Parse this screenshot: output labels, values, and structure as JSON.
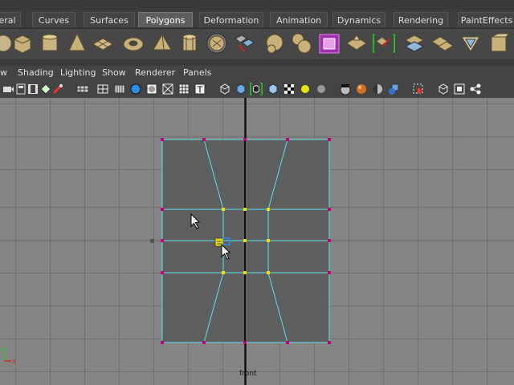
{
  "shelf_tabs": [
    {
      "label": "eral",
      "active": false
    },
    {
      "label": "Curves",
      "active": false
    },
    {
      "label": "Surfaces",
      "active": false
    },
    {
      "label": "Polygons",
      "active": true
    },
    {
      "label": "Deformation",
      "active": false
    },
    {
      "label": "Animation",
      "active": false
    },
    {
      "label": "Dynamics",
      "active": false
    },
    {
      "label": "Rendering",
      "active": false
    },
    {
      "label": "PaintEffects",
      "active": false
    }
  ],
  "shelf_icons": [
    "poly-cube-icon",
    "poly-cylinder-icon",
    "poly-cone-icon",
    "poly-plane-icon",
    "poly-torus-icon",
    "poly-pyramid-icon",
    "poly-pipe-icon",
    "soccer-ball-icon",
    "append-polygon-icon",
    "split-polygon-icon",
    "combine-icon",
    "separate-icon",
    "smooth-proxy-icon",
    "sculpt-icon",
    "extrude-face-icon",
    "extrude-edge-icon",
    "bevel-icon",
    "merge-icon",
    "duplicate-face-icon",
    "poly-tools-icon"
  ],
  "panel_menu": {
    "view": "w",
    "shading": "Shading",
    "lighting": "Lighting",
    "show": "Show",
    "renderer": "Renderer",
    "panels": "Panels"
  },
  "panel_toolbar_icons": [
    "camera-icon",
    "bookmark-icon",
    "film-gate-icon",
    "resolution-gate-icon",
    "field-chart-icon",
    "grid-icon",
    "wireframe-icon",
    "smooth-shade-icon",
    "shade-options-icon",
    "xray-icon",
    "texture-icon",
    "wireframe-on-shaded-icon",
    "isolate-select-icon",
    "high-quality-icon",
    "lights-icon",
    "default-light-icon",
    "shadows-icon",
    "sphere-icon",
    "bounding-box-icon",
    "select-icon",
    "view-cube-icon",
    "two-panes-icon",
    "share-icon"
  ],
  "viewport": {
    "camera_name": "front",
    "axis_y": "Y",
    "axis_x": "X",
    "colors": {
      "background": "#848484",
      "grid": "#6f6f6f",
      "axis": "#111111",
      "mesh_face": "#5e5e5e",
      "mesh_edge": "#5fe0e8",
      "vertex_yellow": "#f0e000",
      "vertex_magenta": "#c0007a"
    }
  }
}
